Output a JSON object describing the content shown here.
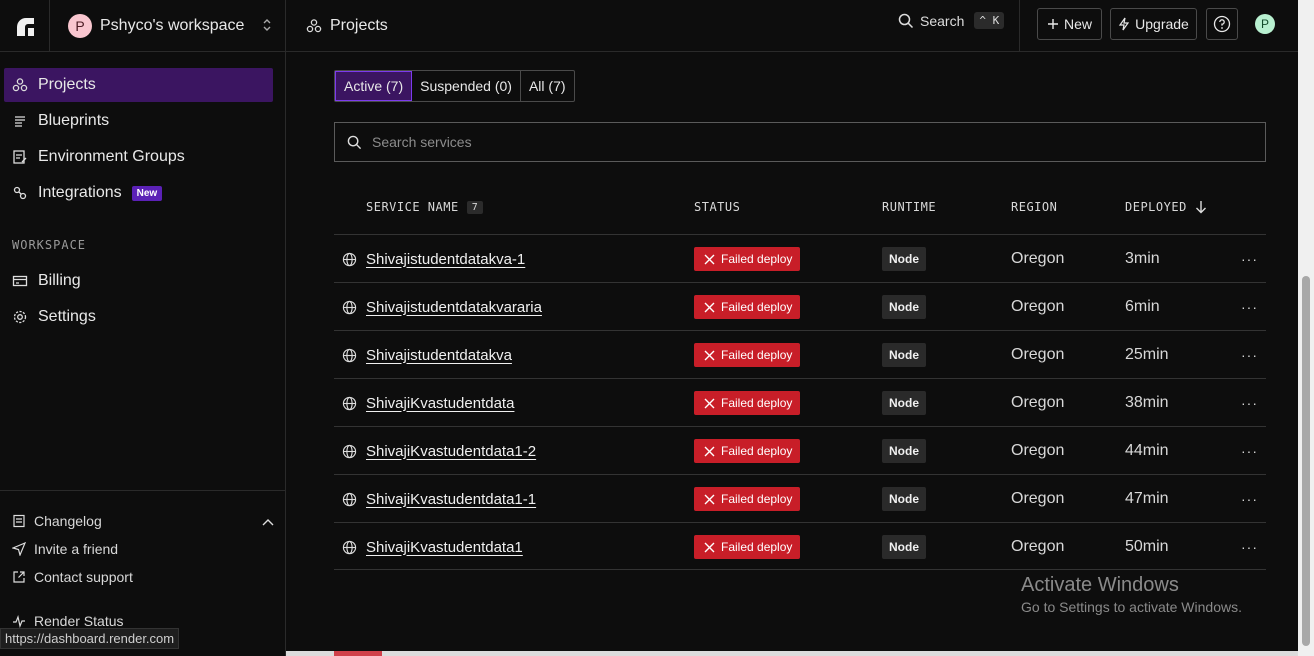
{
  "workspace": {
    "avatar_initial": "P",
    "name": "Pshyco's workspace"
  },
  "header": {
    "breadcrumb": "Projects",
    "search_label": "Search",
    "search_shortcut": "^ K",
    "new_label": "New",
    "upgrade_label": "Upgrade",
    "user_initial": "P"
  },
  "sidebar": {
    "items": [
      {
        "label": "Projects",
        "icon": "projects-icon",
        "active": true
      },
      {
        "label": "Blueprints",
        "icon": "blueprints-icon"
      },
      {
        "label": "Environment Groups",
        "icon": "env-groups-icon"
      },
      {
        "label": "Integrations",
        "icon": "integrations-icon",
        "badge": "New"
      }
    ],
    "section_label": "WORKSPACE",
    "workspace_items": [
      {
        "label": "Billing",
        "icon": "billing-icon"
      },
      {
        "label": "Settings",
        "icon": "gear-icon"
      }
    ],
    "footer": {
      "changelog": "Changelog",
      "invite": "Invite a friend",
      "support": "Contact support",
      "status": "Render Status"
    },
    "url_tooltip": "https://dashboard.render.com"
  },
  "tabs": [
    {
      "label": "Active (7)",
      "active": true
    },
    {
      "label": "Suspended (0)"
    },
    {
      "label": "All (7)"
    }
  ],
  "search": {
    "placeholder": "Search services"
  },
  "table": {
    "headers": {
      "service_name": "SERVICE NAME",
      "count": "7",
      "status": "STATUS",
      "runtime": "RUNTIME",
      "region": "REGION",
      "deployed": "DEPLOYED"
    },
    "rows": [
      {
        "name": "Shivajistudentdatakva-1",
        "status": "Failed deploy",
        "runtime": "Node",
        "region": "Oregon",
        "deployed": "3min"
      },
      {
        "name": "Shivajistudentdatakvararia",
        "status": "Failed deploy",
        "runtime": "Node",
        "region": "Oregon",
        "deployed": "6min"
      },
      {
        "name": "Shivajistudentdatakva",
        "status": "Failed deploy",
        "runtime": "Node",
        "region": "Oregon",
        "deployed": "25min"
      },
      {
        "name": "ShivajiKvastudentdata",
        "status": "Failed deploy",
        "runtime": "Node",
        "region": "Oregon",
        "deployed": "38min"
      },
      {
        "name": "ShivajiKvastudentdata1-2",
        "status": "Failed deploy",
        "runtime": "Node",
        "region": "Oregon",
        "deployed": "44min"
      },
      {
        "name": "ShivajiKvastudentdata1-1",
        "status": "Failed deploy",
        "runtime": "Node",
        "region": "Oregon",
        "deployed": "47min"
      },
      {
        "name": "ShivajiKvastudentdata1",
        "status": "Failed deploy",
        "runtime": "Node",
        "region": "Oregon",
        "deployed": "50min"
      }
    ],
    "more_label": "···"
  },
  "watermark": {
    "title": "Activate Windows",
    "subtitle": "Go to Settings to activate Windows."
  },
  "colors": {
    "accent_purple": "#3b1561",
    "failed_red": "#c81e28",
    "background": "#0d0d0d"
  }
}
